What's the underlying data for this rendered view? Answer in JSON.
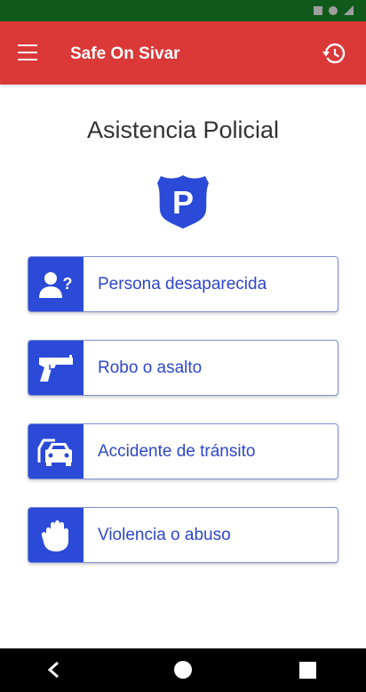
{
  "app": {
    "title": "Safe On Sivar",
    "colors": {
      "app_bar": "#db3838",
      "accent": "#2b4ad8",
      "status_bar": "#0f5a1a"
    }
  },
  "icons": {
    "menu": "menu-icon",
    "history": "history-icon",
    "badge": "police-badge-icon",
    "badge_letter": "P"
  },
  "page": {
    "title": "Asistencia Policial"
  },
  "options": [
    {
      "label": "Persona desaparecida",
      "icon": "missing-person-icon"
    },
    {
      "label": "Robo o asalto",
      "icon": "gun-icon"
    },
    {
      "label": "Accidente de tránsito",
      "icon": "car-crash-icon"
    },
    {
      "label": "Violencia o abuso",
      "icon": "hand-icon"
    }
  ],
  "nav": {
    "back": "back-icon",
    "home": "home-icon",
    "recent": "recent-apps-icon"
  }
}
